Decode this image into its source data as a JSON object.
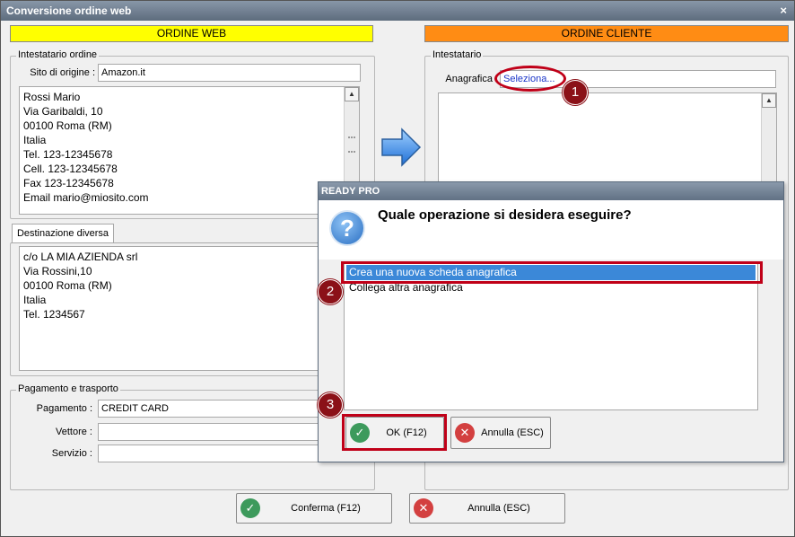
{
  "window": {
    "title": "Conversione ordine web",
    "close_glyph": "×"
  },
  "left": {
    "header": "ORDINE WEB",
    "intestatario": {
      "title": "Intestatario ordine",
      "sito_label": "Sito di origine :",
      "sito_value": "Amazon.it",
      "address_lines": [
        "Rossi Mario",
        "Via Garibaldi, 10",
        "00100 Roma (RM)",
        "Italia",
        "Tel. 123-12345678",
        "Cell. 123-12345678",
        "Fax 123-12345678",
        "Email mario@miosito.com"
      ]
    },
    "destinazione": {
      "tab_label": "Destinazione diversa",
      "address_lines": [
        "c/o LA MIA AZIENDA srl",
        "Via Rossini,10",
        "00100 Roma (RM)",
        "Italia",
        "Tel. 1234567"
      ]
    },
    "pagamento": {
      "title": "Pagamento e trasporto",
      "pagamento_label": "Pagamento :",
      "pagamento_value": "CREDIT CARD",
      "vettore_label": "Vettore :",
      "vettore_value": "",
      "servizio_label": "Servizio :",
      "servizio_value": ""
    }
  },
  "right": {
    "header": "ORDINE CLIENTE",
    "intestatario": {
      "title": "Intestatario",
      "anagrafica_label": "Anagrafica",
      "anagrafica_link": "Seleziona..."
    }
  },
  "footer": {
    "confirm_label": "Conferma (F12)",
    "cancel_label": "Annulla (ESC)"
  },
  "modal": {
    "title": "READY PRO",
    "question": "Quale operazione si desidera eseguire?",
    "options": [
      "Crea una nuova scheda anagrafica",
      "Collega altra anagrafica"
    ],
    "selected_index": 0,
    "ok_label": "OK (F12)",
    "cancel_label": "Annulla (ESC)"
  },
  "callouts": {
    "one": "1",
    "two": "2",
    "three": "3"
  },
  "icons": {
    "ok": "check-icon",
    "cancel": "x-icon",
    "question": "question-icon",
    "arrow": "arrow-right-icon"
  },
  "colors": {
    "ordine_web": "#ffff00",
    "ordine_cliente": "#ff8c14",
    "callout": "#c00018",
    "selection": "#3b88d8"
  }
}
